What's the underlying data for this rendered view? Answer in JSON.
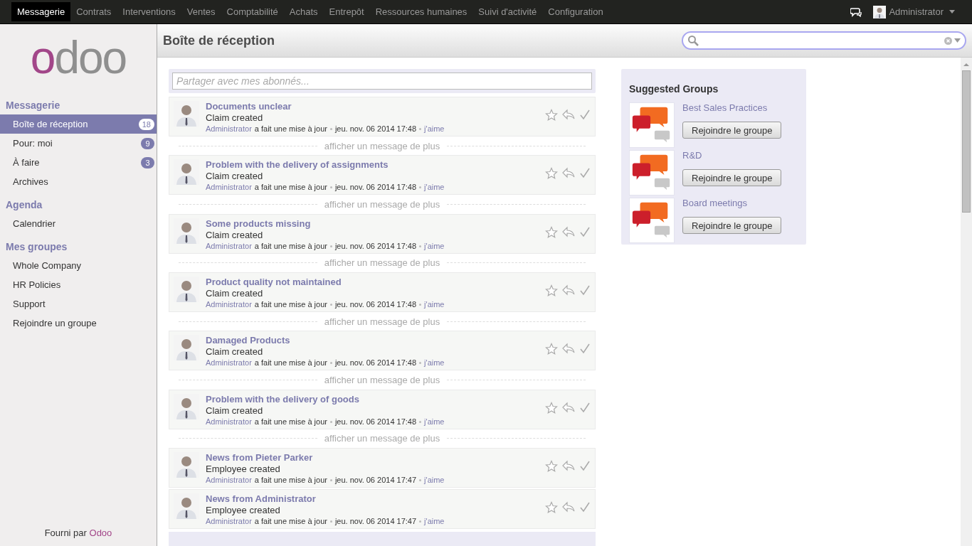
{
  "top_menu": [
    {
      "label": "Messagerie",
      "selected": true
    },
    {
      "label": "Contrats",
      "selected": false
    },
    {
      "label": "Interventions",
      "selected": false
    },
    {
      "label": "Ventes",
      "selected": false
    },
    {
      "label": "Comptabilité",
      "selected": false
    },
    {
      "label": "Achats",
      "selected": false
    },
    {
      "label": "Entrepôt",
      "selected": false
    },
    {
      "label": "Ressources humaines",
      "selected": false
    },
    {
      "label": "Suivi d'activité",
      "selected": false
    },
    {
      "label": "Configuration",
      "selected": false
    }
  ],
  "user": {
    "name": "Administrator"
  },
  "logo": "odoo",
  "sidebar": {
    "sections": [
      {
        "title": "Messagerie",
        "items": [
          {
            "label": "Boîte de réception",
            "badge": "18",
            "selected": true
          },
          {
            "label": "Pour: moi",
            "badge": "9",
            "selected": false
          },
          {
            "label": "À faire",
            "badge": "3",
            "selected": false
          },
          {
            "label": "Archives",
            "selected": false
          }
        ]
      },
      {
        "title": "Agenda",
        "items": [
          {
            "label": "Calendrier",
            "selected": false
          }
        ]
      },
      {
        "title": "Mes groupes",
        "items": [
          {
            "label": "Whole Company",
            "selected": false
          },
          {
            "label": "HR Policies",
            "selected": false
          },
          {
            "label": "Support",
            "selected": false
          },
          {
            "label": "Rejoindre un groupe",
            "selected": false
          }
        ]
      }
    ]
  },
  "powered_by": {
    "text": "Fourni par",
    "link": "Odoo"
  },
  "page_title": "Boîte de réception",
  "composer": {
    "placeholder": "Partager avec mes abonnés..."
  },
  "messages": [
    {
      "title": "Documents unclear",
      "body": "Claim created",
      "author": "Administrator",
      "action": "a fait une mise à jour",
      "date": "jeu. nov. 06 2014 17:48",
      "like": "j'aime",
      "more_after": "afficher un message de plus"
    },
    {
      "title": "Problem with the delivery of assignments",
      "body": "Claim created",
      "author": "Administrator",
      "action": "a fait une mise à jour",
      "date": "jeu. nov. 06 2014 17:48",
      "like": "j'aime",
      "more_after": "afficher un message de plus"
    },
    {
      "title": "Some products missing",
      "body": "Claim created",
      "author": "Administrator",
      "action": "a fait une mise à jour",
      "date": "jeu. nov. 06 2014 17:48",
      "like": "j'aime",
      "more_after": "afficher un message de plus"
    },
    {
      "title": "Product quality not maintained",
      "body": "Claim created",
      "author": "Administrator",
      "action": "a fait une mise à jour",
      "date": "jeu. nov. 06 2014 17:48",
      "like": "j'aime",
      "more_after": "afficher un message de plus"
    },
    {
      "title": "Damaged Products",
      "body": "Claim created",
      "author": "Administrator",
      "action": "a fait une mise à jour",
      "date": "jeu. nov. 06 2014 17:48",
      "like": "j'aime",
      "more_after": "afficher un message de plus"
    },
    {
      "title": "Problem with the delivery of goods",
      "body": "Claim created",
      "author": "Administrator",
      "action": "a fait une mise à jour",
      "date": "jeu. nov. 06 2014 17:48",
      "like": "j'aime",
      "more_after": "afficher un message de plus"
    },
    {
      "title": "News from Pieter Parker",
      "body": "Employee created",
      "author": "Administrator",
      "action": "a fait une mise à jour",
      "date": "jeu. nov. 06 2014 17:47",
      "like": "j'aime"
    },
    {
      "title": "News from Administrator",
      "body": "Employee created",
      "author": "Administrator",
      "action": "a fait une mise à jour",
      "date": "jeu. nov. 06 2014 17:47",
      "like": "j'aime"
    }
  ],
  "suggested_groups": {
    "title": "Suggested Groups",
    "groups": [
      {
        "name": "Best Sales Practices",
        "button": "Rejoindre le groupe"
      },
      {
        "name": "R&D",
        "button": "Rejoindre le groupe"
      },
      {
        "name": "Board meetings",
        "button": "Rejoindre le groupe"
      }
    ]
  }
}
